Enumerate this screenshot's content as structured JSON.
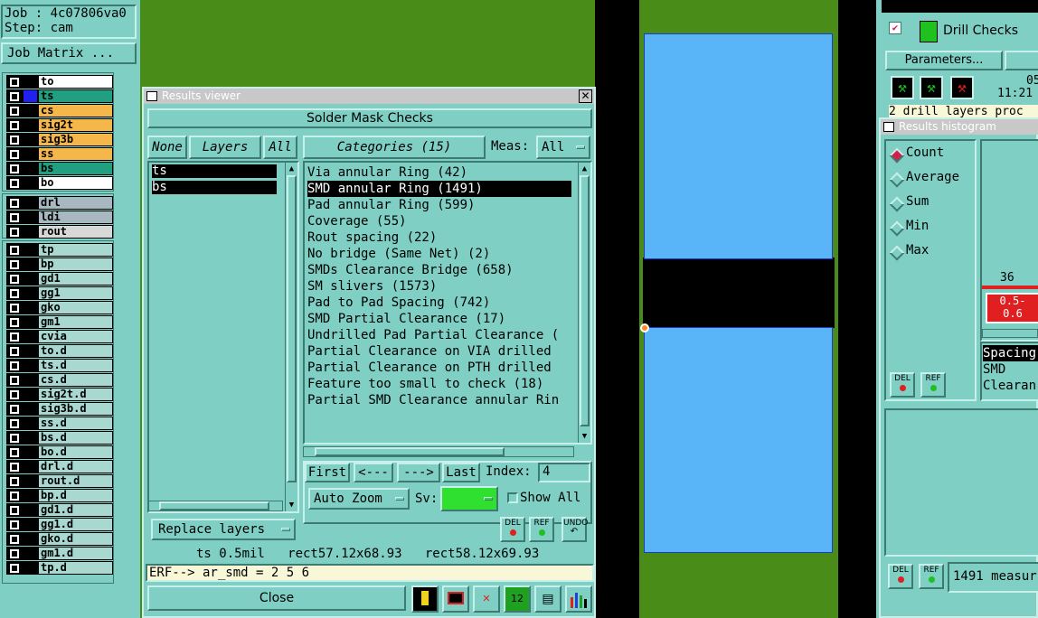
{
  "left": {
    "job": "Job : 4c07806va0",
    "step": "Step: cam",
    "job_matrix": "Job Matrix ...",
    "layers_top": [
      {
        "name": "to",
        "color": "#ffffff"
      },
      {
        "name": "ts",
        "color": "#20a080"
      },
      {
        "name": "cs",
        "color": "#f5b74a"
      },
      {
        "name": "sig2t",
        "color": "#f5b74a"
      },
      {
        "name": "sig3b",
        "color": "#f5b74a"
      },
      {
        "name": "ss",
        "color": "#f5b74a"
      },
      {
        "name": "bs",
        "color": "#20a080"
      },
      {
        "name": "bo",
        "color": "#ffffff"
      }
    ],
    "layers_drill": [
      {
        "name": "drl",
        "color": "#a8b8c0"
      },
      {
        "name": "ldi",
        "color": "#a8b8c0"
      },
      {
        "name": "rout",
        "color": "#d8d8d8"
      }
    ],
    "layers_misc": [
      "tp",
      "bp",
      "gd1",
      "gg1",
      "gko",
      "gm1",
      "cvia",
      "to.d",
      "ts.d",
      "cs.d",
      "sig2t.d",
      "sig3b.d",
      "ss.d",
      "bs.d",
      "bo.d",
      "drl.d",
      "rout.d",
      "bp.d",
      "gd1.d",
      "gg1.d",
      "gko.d",
      "gm1.d",
      "tp.d"
    ]
  },
  "results_viewer": {
    "title": "Results viewer",
    "header": "Solder Mask Checks",
    "none_btn": "None",
    "layers_btn": "Layers",
    "all_btn": "All",
    "categories_btn": "Categories (15)",
    "meas_label": "Meas:",
    "meas_value": "All",
    "layers": [
      "ts",
      "bs"
    ],
    "categories": [
      "Via annular Ring (42)",
      "SMD annular Ring (1491)",
      "Pad annular Ring (599)",
      "Coverage (55)",
      "Rout spacing (22)",
      "No bridge (Same Net) (2)",
      "SMDs Clearance Bridge (658)",
      "SM slivers (1573)",
      "Pad to Pad Spacing (742)",
      "SMD Partial Clearance (17)",
      "Undrilled Pad Partial Clearance (",
      "Partial Clearance on VIA drilled",
      "Partial Clearance on PTH drilled",
      "Feature too small to check (18)",
      "Partial SMD Clearance annular Rin"
    ],
    "selected_category": 1,
    "first": "First",
    "prev": "<---",
    "next": "--->",
    "last": "Last",
    "index_label": "Index:",
    "index_value": "4",
    "auto_zoom": "Auto Zoom",
    "sv_label": "Sv:",
    "show_all": "Show All",
    "replace_layers": "Replace layers",
    "del": "DEL",
    "ref": "REF",
    "undo": "UNDO",
    "status": "ts 0.5mil   rect57.12x68.93   rect58.12x69.93",
    "erf": "ERF--> ar_smd = 2 5 6",
    "close": "Close"
  },
  "drill_checks": {
    "title": "Drill Checks",
    "parameters": "Parameters...",
    "time_top": "05",
    "time": "11:21",
    "status_line": "2 drill layers proc"
  },
  "histogram": {
    "title": "Results histogram",
    "options": [
      "Count",
      "Average",
      "Sum",
      "Min",
      "Max"
    ],
    "selected": 0,
    "bar_count": "36",
    "bar_range_a": "0.5-",
    "bar_range_b": "0.6",
    "list": [
      "Spacing",
      "SMD",
      "Clearan"
    ],
    "measures": "1491 measur"
  }
}
